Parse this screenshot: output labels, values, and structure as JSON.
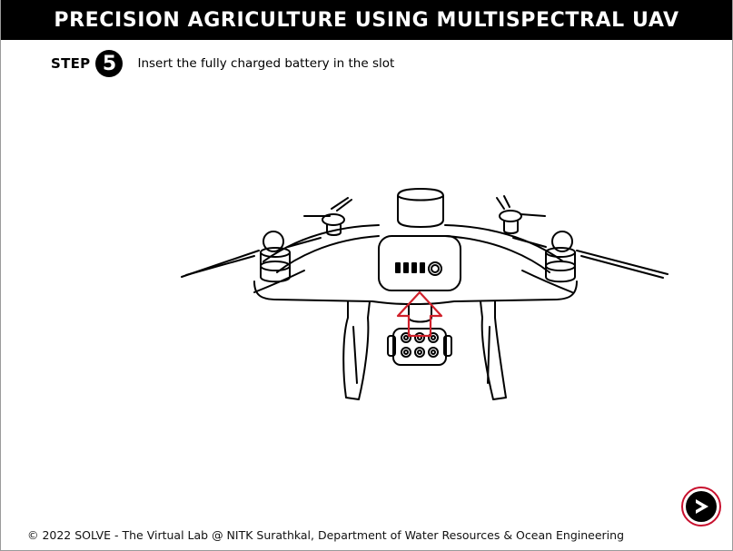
{
  "header": {
    "title": "PRECISION AGRICULTURE USING MULTISPECTRAL UAV"
  },
  "step": {
    "label": "STEP",
    "number": "5",
    "instruction": "Insert the fully charged battery in the slot"
  },
  "illustration": {
    "subject": "multispectral UAV drone with battery slot",
    "highlight_color": "#d0202a"
  },
  "footer": {
    "copyright": "© 2022 SOLVE - The Virtual Lab @ NITK Surathkal, Department of Water Resources & Ocean Engineering"
  },
  "nav": {
    "next_icon": "next-arrow-icon",
    "next_ring_color": "#c8102e"
  }
}
